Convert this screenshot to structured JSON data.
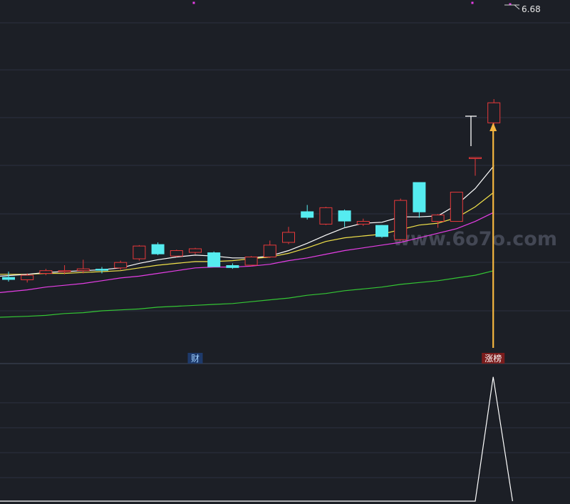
{
  "chart_data": [
    {
      "type": "candlestick",
      "price_label": "6.68",
      "ylim": [
        3.2,
        6.95
      ],
      "grid": true,
      "colors": {
        "up": "#e8393a",
        "down": "#55ecf0",
        "ma_white": "#ffffff",
        "ma_yellow": "#f2e24a",
        "ma_magenta": "#e63ee6",
        "ma_green": "#34c734",
        "arrow": "#f4b53f",
        "marker": "#e63ee6"
      },
      "candles": [
        {
          "o": 4.07,
          "h": 4.13,
          "l": 4.02,
          "c": 4.04
        },
        {
          "o": 4.04,
          "h": 4.11,
          "l": 4.01,
          "c": 4.09
        },
        {
          "o": 4.11,
          "h": 4.16,
          "l": 4.09,
          "c": 4.14
        },
        {
          "o": 4.13,
          "h": 4.2,
          "l": 4.1,
          "c": 4.14
        },
        {
          "o": 4.14,
          "h": 4.26,
          "l": 4.11,
          "c": 4.16
        },
        {
          "o": 4.16,
          "h": 4.18,
          "l": 4.11,
          "c": 4.14
        },
        {
          "o": 4.17,
          "h": 4.25,
          "l": 4.15,
          "c": 4.23
        },
        {
          "o": 4.27,
          "h": 4.42,
          "l": 4.25,
          "c": 4.41
        },
        {
          "o": 4.43,
          "h": 4.45,
          "l": 4.31,
          "c": 4.32
        },
        {
          "o": 4.3,
          "h": 4.37,
          "l": 4.29,
          "c": 4.36
        },
        {
          "o": 4.34,
          "h": 4.39,
          "l": 4.32,
          "c": 4.38
        },
        {
          "o": 4.34,
          "h": 4.35,
          "l": 4.18,
          "c": 4.18
        },
        {
          "o": 4.2,
          "h": 4.22,
          "l": 4.16,
          "c": 4.17
        },
        {
          "o": 4.2,
          "h": 4.3,
          "l": 4.19,
          "c": 4.29
        },
        {
          "o": 4.29,
          "h": 4.47,
          "l": 4.28,
          "c": 4.42
        },
        {
          "o": 4.45,
          "h": 4.62,
          "l": 4.43,
          "c": 4.56
        },
        {
          "o": 4.79,
          "h": 4.86,
          "l": 4.7,
          "c": 4.72
        },
        {
          "o": 4.65,
          "h": 4.84,
          "l": 4.64,
          "c": 4.83
        },
        {
          "o": 4.8,
          "h": 4.81,
          "l": 4.62,
          "c": 4.68
        },
        {
          "o": 4.65,
          "h": 4.71,
          "l": 4.63,
          "c": 4.68
        },
        {
          "o": 4.64,
          "h": 4.64,
          "l": 4.5,
          "c": 4.51
        },
        {
          "o": 4.48,
          "h": 4.93,
          "l": 4.47,
          "c": 4.91
        },
        {
          "o": 5.11,
          "h": 5.11,
          "l": 4.72,
          "c": 4.78
        },
        {
          "o": 4.68,
          "h": 4.76,
          "l": 4.61,
          "c": 4.75
        },
        {
          "o": 4.68,
          "h": 5.0,
          "l": 4.68,
          "c": 5.0
        },
        {
          "o": 5.38,
          "h": 5.38,
          "l": 5.18,
          "c": 5.38
        },
        {
          "o": 5.76,
          "h": 6.02,
          "l": 5.72,
          "c": 5.98
        }
      ],
      "ma_white": [
        4.08,
        4.1,
        4.12,
        4.13,
        4.14,
        4.15,
        4.17,
        4.22,
        4.26,
        4.29,
        4.31,
        4.3,
        4.28,
        4.28,
        4.3,
        4.36,
        4.44,
        4.53,
        4.61,
        4.66,
        4.67,
        4.73,
        4.73,
        4.74,
        4.86,
        5.04,
        5.29
      ],
      "ma_yellow": [
        4.1,
        4.1,
        4.11,
        4.11,
        4.12,
        4.13,
        4.14,
        4.17,
        4.2,
        4.22,
        4.24,
        4.24,
        4.25,
        4.27,
        4.29,
        4.33,
        4.39,
        4.46,
        4.5,
        4.52,
        4.54,
        4.59,
        4.64,
        4.66,
        4.72,
        4.84,
        5.0
      ],
      "ma_magenta": [
        3.9,
        3.93,
        3.96,
        3.98,
        4.0,
        4.03,
        4.06,
        4.08,
        4.11,
        4.14,
        4.17,
        4.18,
        4.18,
        4.19,
        4.21,
        4.25,
        4.28,
        4.32,
        4.36,
        4.39,
        4.42,
        4.45,
        4.5,
        4.55,
        4.6,
        4.68,
        4.78
      ],
      "ma_green": [
        3.63,
        3.64,
        3.65,
        3.67,
        3.68,
        3.7,
        3.71,
        3.72,
        3.74,
        3.75,
        3.76,
        3.77,
        3.78,
        3.8,
        3.82,
        3.84,
        3.87,
        3.89,
        3.92,
        3.94,
        3.96,
        3.99,
        4.01,
        4.03,
        4.06,
        4.09,
        4.14
      ],
      "markers": [
        {
          "index": 10,
          "text": "财"
        },
        {
          "index": 26,
          "text": "涨榜"
        }
      ]
    },
    {
      "type": "line",
      "values": [
        0,
        0,
        0,
        0,
        0,
        0,
        0,
        0,
        0,
        0,
        0,
        0,
        0,
        0,
        0,
        0,
        0,
        0,
        0,
        0,
        0,
        0,
        0,
        0,
        0,
        0,
        1,
        0
      ],
      "ylim": [
        0,
        1.05
      ],
      "grid": true
    }
  ],
  "watermark": "www.6o7o.com"
}
